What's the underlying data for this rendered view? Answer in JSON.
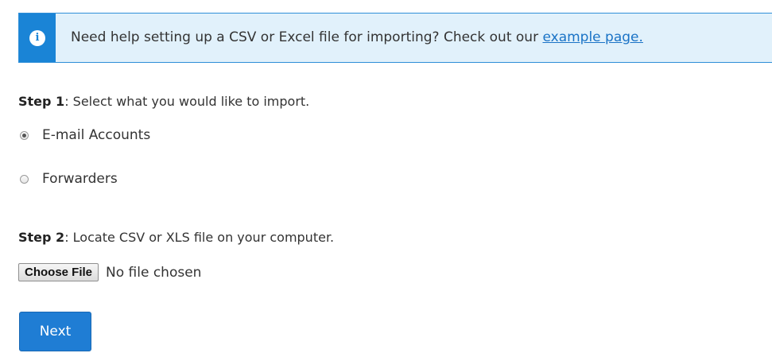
{
  "alert": {
    "icon": "info-icon",
    "text": "Need help setting up a CSV or Excel file for importing? Check out our ",
    "link_text": "example page.",
    "accent_color": "#1a84d6",
    "background_color": "#e1f1fb"
  },
  "step1": {
    "label": "Step 1",
    "text": ": Select what you would like to import.",
    "options": [
      {
        "label": "E-mail Accounts",
        "checked": true
      },
      {
        "label": "Forwarders",
        "checked": false
      }
    ]
  },
  "step2": {
    "label": "Step 2",
    "text": ": Locate CSV or XLS file on your computer.",
    "choose_button": "Choose File",
    "file_status": "No file chosen"
  },
  "next_button": {
    "label": "Next",
    "color": "#1f7dd4"
  }
}
